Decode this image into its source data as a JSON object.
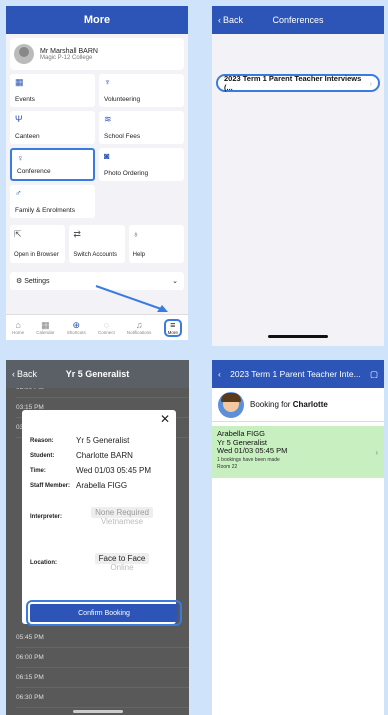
{
  "panel1": {
    "header_title": "More",
    "user_name": "Mr Marshall BARN",
    "school": "Magic P-12 College",
    "tiles": [
      {
        "label": "Events",
        "icon": "calendar-icon"
      },
      {
        "label": "Volunteering",
        "icon": "volunteer-icon"
      },
      {
        "label": "Canteen",
        "icon": "cutlery-icon"
      },
      {
        "label": "School Fees",
        "icon": "money-icon"
      },
      {
        "label": "Conference",
        "icon": "conference-icon"
      },
      {
        "label": "Photo Ordering",
        "icon": "camera-icon"
      },
      {
        "label": "Family & Enrolments",
        "icon": "family-icon"
      }
    ],
    "small_tiles": [
      {
        "label": "Open in Browser",
        "icon": "external-icon"
      },
      {
        "label": "Switch Accounts",
        "icon": "switch-icon"
      },
      {
        "label": "Help",
        "icon": "help-icon"
      }
    ],
    "settings_label": "Settings",
    "tabs": [
      "Home",
      "Calendar",
      "Shortcuts",
      "Connect",
      "Notifications",
      "More"
    ],
    "arrow_color": "#3a7be0"
  },
  "panel2": {
    "back_label": "Back",
    "title": "Conferences",
    "conference_name": "2023 Term 1 Parent Teacher Interviews (..."
  },
  "panel3": {
    "back_label": "Back",
    "title": "Yr 5 Generalist",
    "times": [
      "03:00 PM",
      "03:15 PM",
      "03:30 PM"
    ],
    "times_after": [
      "05:45 PM",
      "06:00 PM",
      "06:15 PM",
      "06:30 PM"
    ],
    "reason_key": "Reason:",
    "reason": "Yr 5 Generalist",
    "student_key": "Student:",
    "student": "Charlotte BARN",
    "time_key": "Time:",
    "time": "Wed 01/03 05:45 PM",
    "staff_key": "Staff Member:",
    "staff": "Arabella FIGG",
    "interpreter_key": "Interpreter:",
    "interpreter_selected": "None Required",
    "interpreter_alt": "Vietnamese",
    "location_key": "Location:",
    "location_selected": "Face to Face",
    "location_alt": "Online",
    "confirm_label": "Confirm Booking"
  },
  "panel4": {
    "title": "2023 Term 1 Parent Teacher Inte...",
    "booking_for_prefix": "Booking for ",
    "booking_for_name": "Charlotte",
    "teacher": "Arabella FIGG",
    "subject": "Yr 5 Generalist",
    "datetime": "Wed 01/03 05:45 PM",
    "bookings_note": "1 bookings have been made",
    "room": "Room 22"
  },
  "colors": {
    "brand": "#2c55b7",
    "highlight": "#3a7be0",
    "booked": "#c7efc0"
  }
}
